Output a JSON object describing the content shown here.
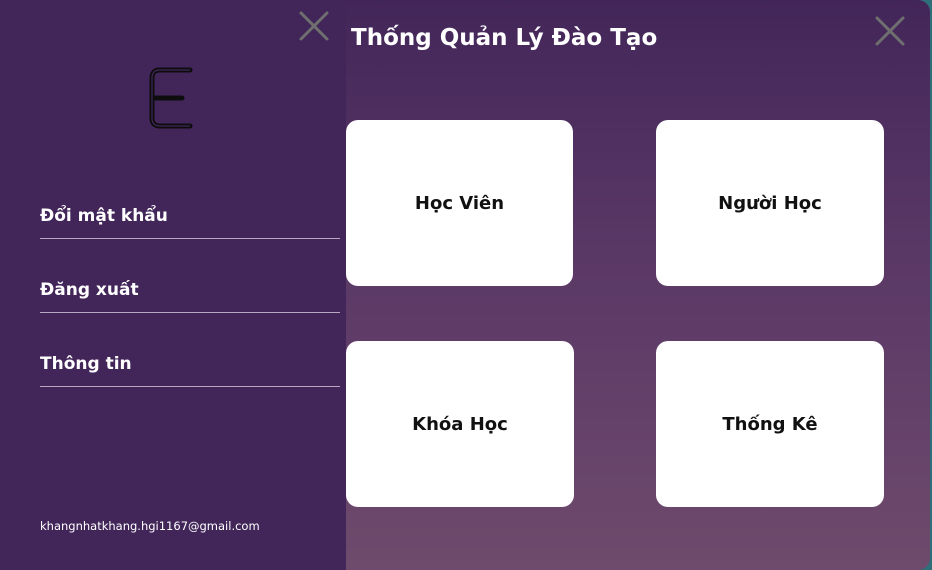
{
  "window": {
    "title": "Thống Quản Lý Đào Tạo"
  },
  "sidebar": {
    "logo_icon": "letter-e-logo",
    "items": [
      {
        "label": "Đổi mật khẩu"
      },
      {
        "label": "Đăng xuất"
      },
      {
        "label": "Thông tin"
      }
    ],
    "email": "khangnhatkhang.hgi1167@gmail.com"
  },
  "cards": [
    {
      "label": "Học Viên"
    },
    {
      "label": "Người Học"
    },
    {
      "label": "Khóa Học"
    },
    {
      "label": "Thống Kê"
    }
  ],
  "icons": {
    "close": "close-icon"
  },
  "colors": {
    "sidebar_bg": "#42265a",
    "main_bg_top": "#432659",
    "main_bg_bottom": "#6e4a6c",
    "card_bg": "#ffffff",
    "divider": "#b9a8c4",
    "close_icon": "#6f6f6f"
  }
}
